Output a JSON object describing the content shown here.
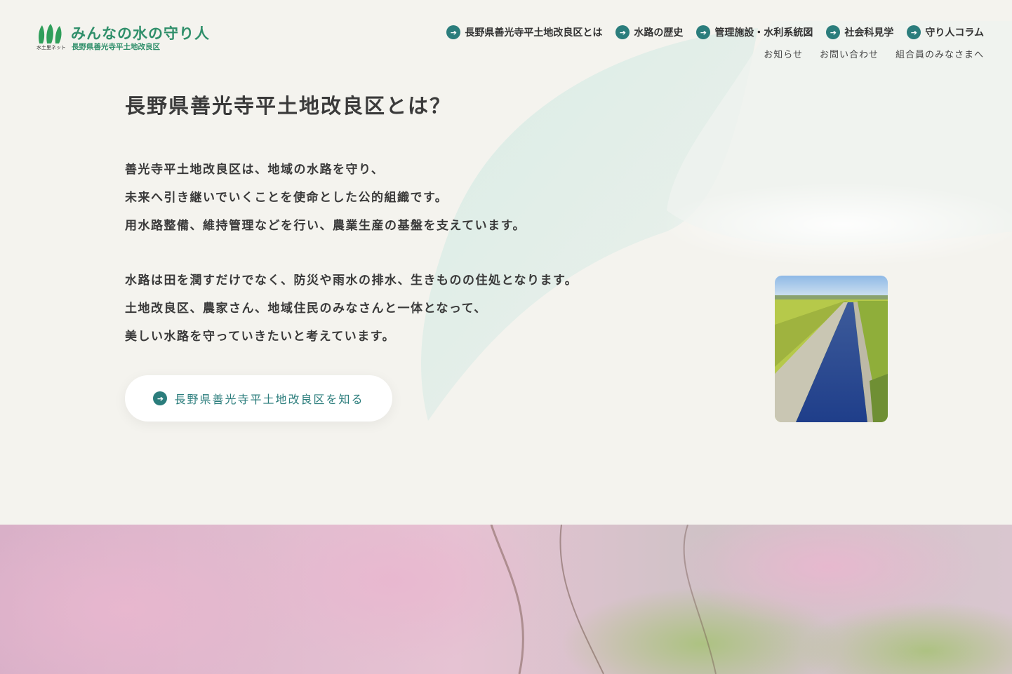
{
  "logo": {
    "title": "みんなの水の守り人",
    "subtitle": "長野県善光寺平土地改良区",
    "net_label": "水土里ネット"
  },
  "nav": {
    "main": [
      {
        "label": "長野県善光寺平土地改良区とは",
        "icon": "arrow-right-circle-icon"
      },
      {
        "label": "水路の歴史",
        "icon": "arrow-right-circle-icon"
      },
      {
        "label": "管理施設・水利系統図",
        "icon": "arrow-right-circle-icon"
      },
      {
        "label": "社会科見学",
        "icon": "arrow-right-circle-icon"
      },
      {
        "label": "守り人コラム",
        "icon": "arrow-right-circle-icon"
      }
    ],
    "sub": [
      {
        "label": "お知らせ"
      },
      {
        "label": "お問い合わせ"
      },
      {
        "label": "組合員のみなさまへ"
      }
    ]
  },
  "main": {
    "title": "長野県善光寺平土地改良区とは？",
    "paragraphs": [
      {
        "lines": [
          "善光寺平土地改良区は、地域の水路を守り、",
          "未来へ引き継いでいくことを使命とした公的組織です。",
          "用水路整備、維持管理などを行い、農業生産の基盤を支えています。"
        ]
      },
      {
        "lines": [
          "水路は田を潤すだけでなく、防災や雨水の排水、生きものの住処となります。",
          "土地改良区、農家さん、地域住民のみなさんと一体となって、",
          "美しい水路を守っていきたいと考えています。"
        ]
      }
    ],
    "cta_label": "長野県善光寺平土地改良区を知る"
  },
  "colors": {
    "accent": "#2b7d7c",
    "brand_green": "#2f8f6a",
    "background": "#f4f3ee"
  }
}
